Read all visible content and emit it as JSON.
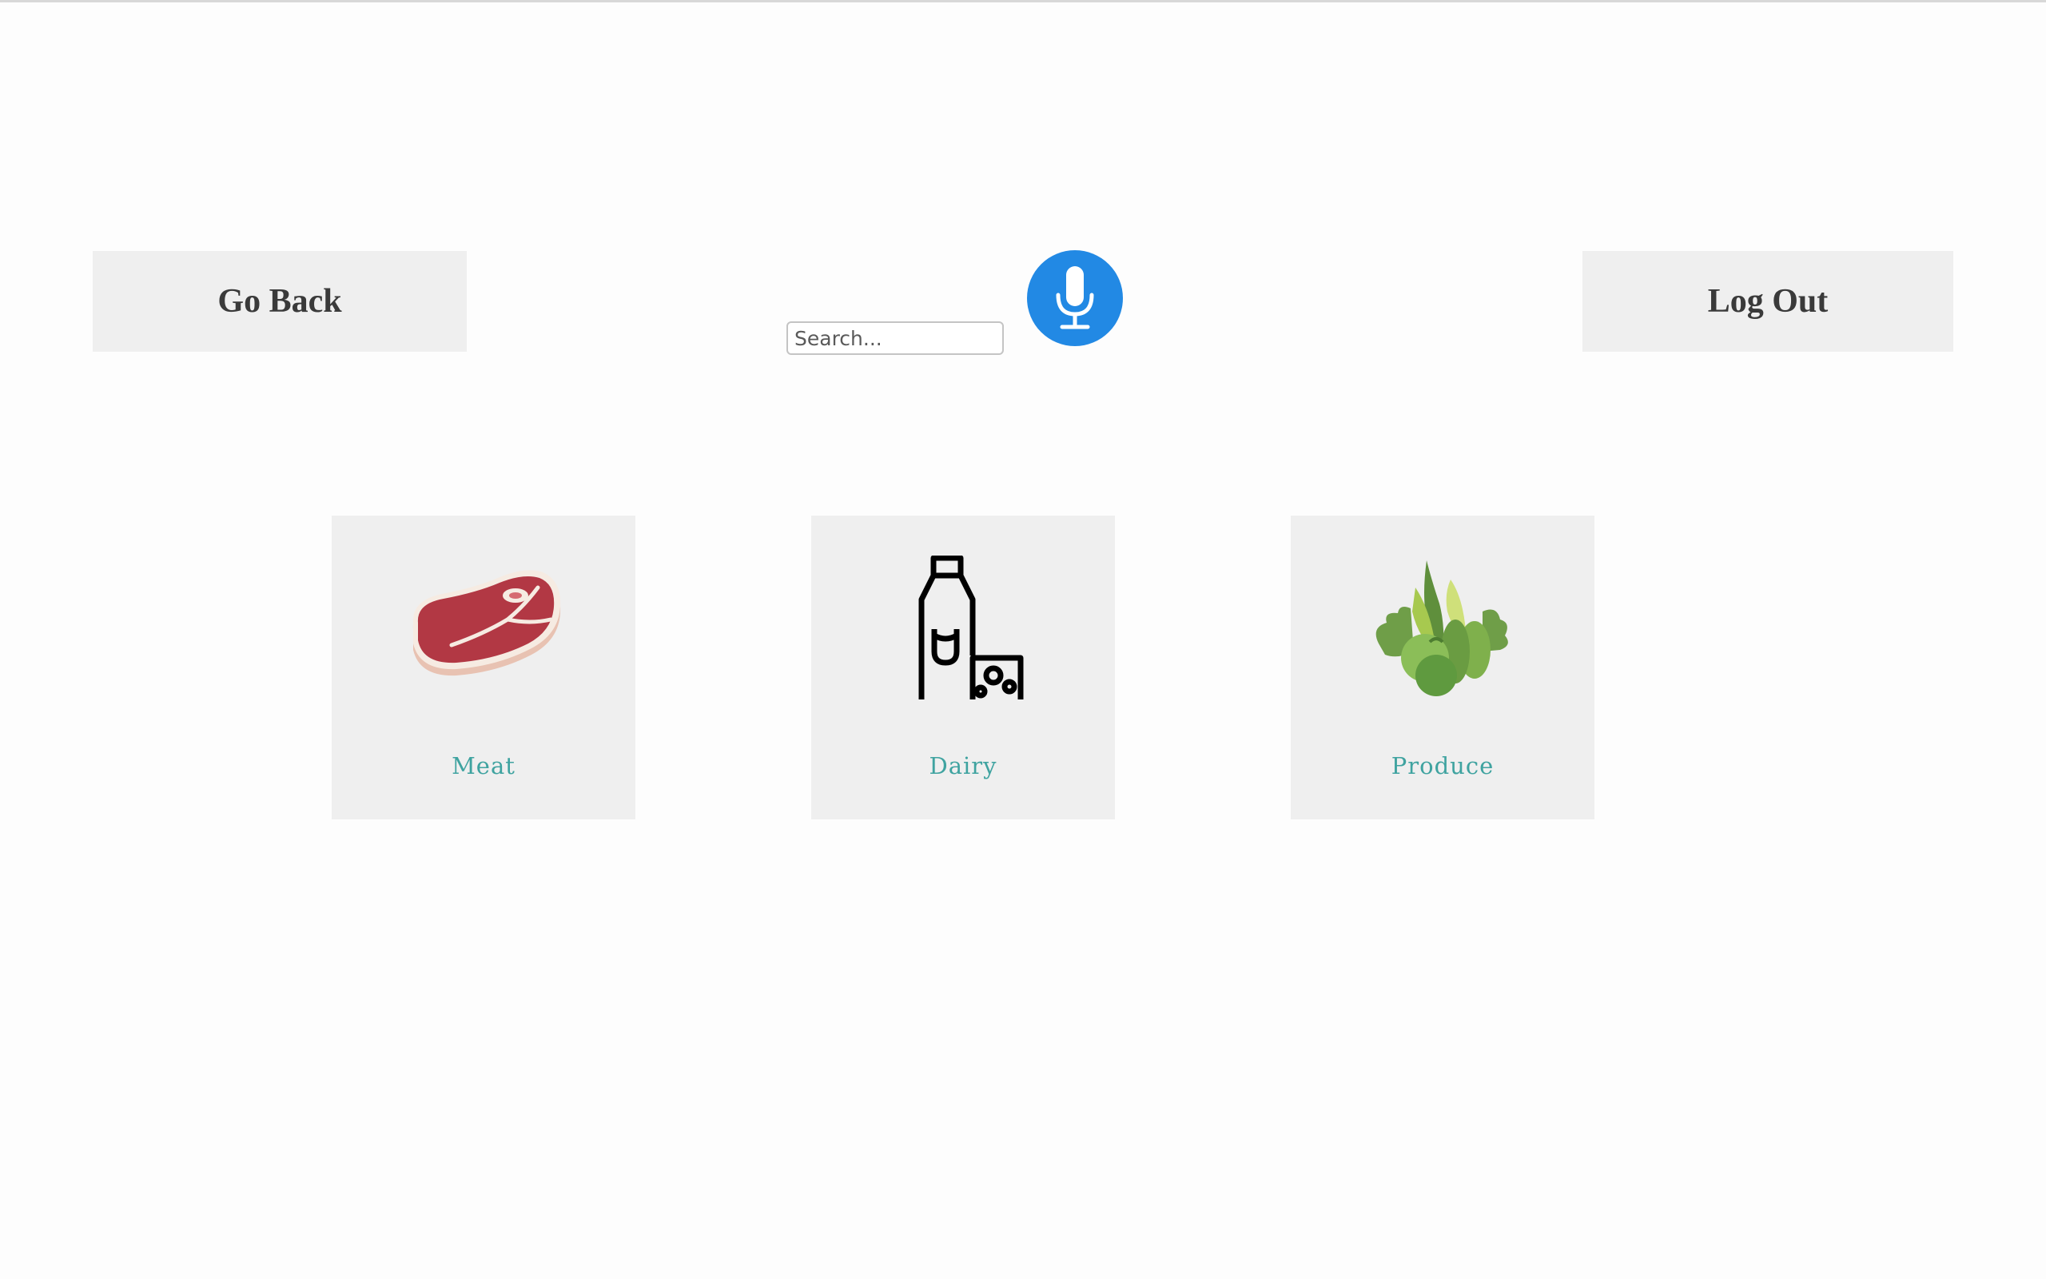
{
  "header": {
    "go_back_label": "Go Back",
    "log_out_label": "Log Out"
  },
  "search": {
    "placeholder": "Search...",
    "value": "",
    "mic_icon": "microphone-icon",
    "mic_color": "#2289e4"
  },
  "categories": [
    {
      "label": "Meat",
      "icon": "steak-icon"
    },
    {
      "label": "Dairy",
      "icon": "milk-cheese-icon"
    },
    {
      "label": "Produce",
      "icon": "vegetables-icon"
    }
  ],
  "colors": {
    "card_background": "#efefef",
    "category_label": "#3fa3a0",
    "button_text": "#3a3a3a"
  }
}
